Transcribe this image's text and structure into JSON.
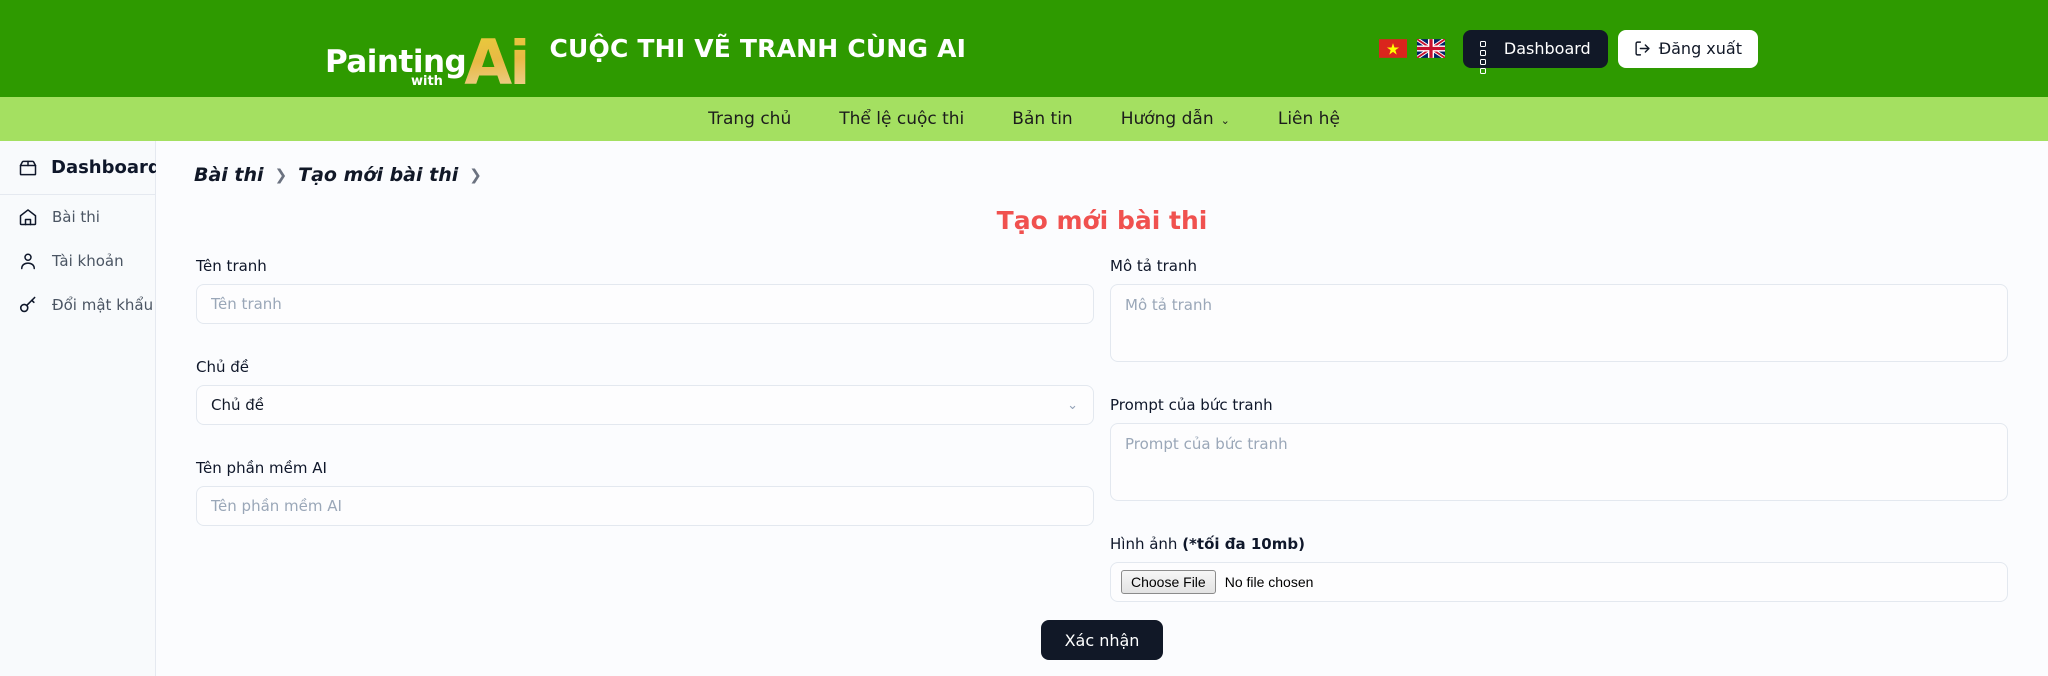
{
  "header": {
    "logo": {
      "word1": "Painting",
      "word2": "with",
      "word3": "Ai"
    },
    "title": "CUỘC THI VẼ TRANH CÙNG AI",
    "flags": [
      {
        "name": "vietnam-flag",
        "label": "Tiếng Việt"
      },
      {
        "name": "uk-flag",
        "label": "English"
      }
    ],
    "dashboard_button": "Dashboard",
    "logout_button": "Đăng xuất",
    "bg_color": "#2e9a00"
  },
  "nav": {
    "bg_color": "#a4e061",
    "items": [
      {
        "label": "Trang chủ",
        "has_caret": false
      },
      {
        "label": "Thể lệ cuộc thi",
        "has_caret": false
      },
      {
        "label": "Bản tin",
        "has_caret": false
      },
      {
        "label": "Hướng dẫn",
        "has_caret": true
      },
      {
        "label": "Liên hệ",
        "has_caret": false
      }
    ],
    "caret_glyph": "⌄"
  },
  "sidebar": {
    "header": {
      "label": "Dashboard",
      "icon": "box-icon"
    },
    "items": [
      {
        "label": "Bài thi",
        "icon": "home-icon"
      },
      {
        "label": "Tài khoản",
        "icon": "user-icon"
      },
      {
        "label": "Đổi mật khẩu",
        "icon": "key-icon"
      }
    ]
  },
  "breadcrumb": {
    "item1": "Bài thi",
    "sep1": "❯",
    "item2": "Tạo mới bài thi",
    "sep2": "❯"
  },
  "page": {
    "title": "Tạo mới bài thi",
    "title_color": "#f0514f"
  },
  "form": {
    "left": [
      {
        "name": "ten-tranh",
        "label": "Tên tranh",
        "placeholder": "Tên tranh",
        "value": "",
        "type": "text"
      },
      {
        "name": "chu-de",
        "label": "Chủ đề",
        "placeholder": "Chủ đề",
        "value": "Chủ đề",
        "type": "select"
      },
      {
        "name": "ten-phan-mem-ai",
        "label": "Tên phần mềm AI",
        "placeholder": "Tên phần mềm AI",
        "value": "",
        "type": "text"
      }
    ],
    "right": [
      {
        "name": "mo-ta-tranh",
        "label": "Mô tả tranh",
        "placeholder": "Mô tả tranh",
        "value": "",
        "type": "textarea"
      },
      {
        "name": "prompt-buc-tranh",
        "label": "Prompt của bức tranh",
        "placeholder": "Prompt của bức tranh",
        "value": "",
        "type": "textarea"
      },
      {
        "name": "hinh-anh",
        "label_plain": "Hình ảnh ",
        "label_bold": "(*tối đa 10mb)",
        "type": "file",
        "choose_button": "Choose File",
        "file_status": "No file chosen"
      }
    ],
    "submit_button": "Xác nhận"
  }
}
